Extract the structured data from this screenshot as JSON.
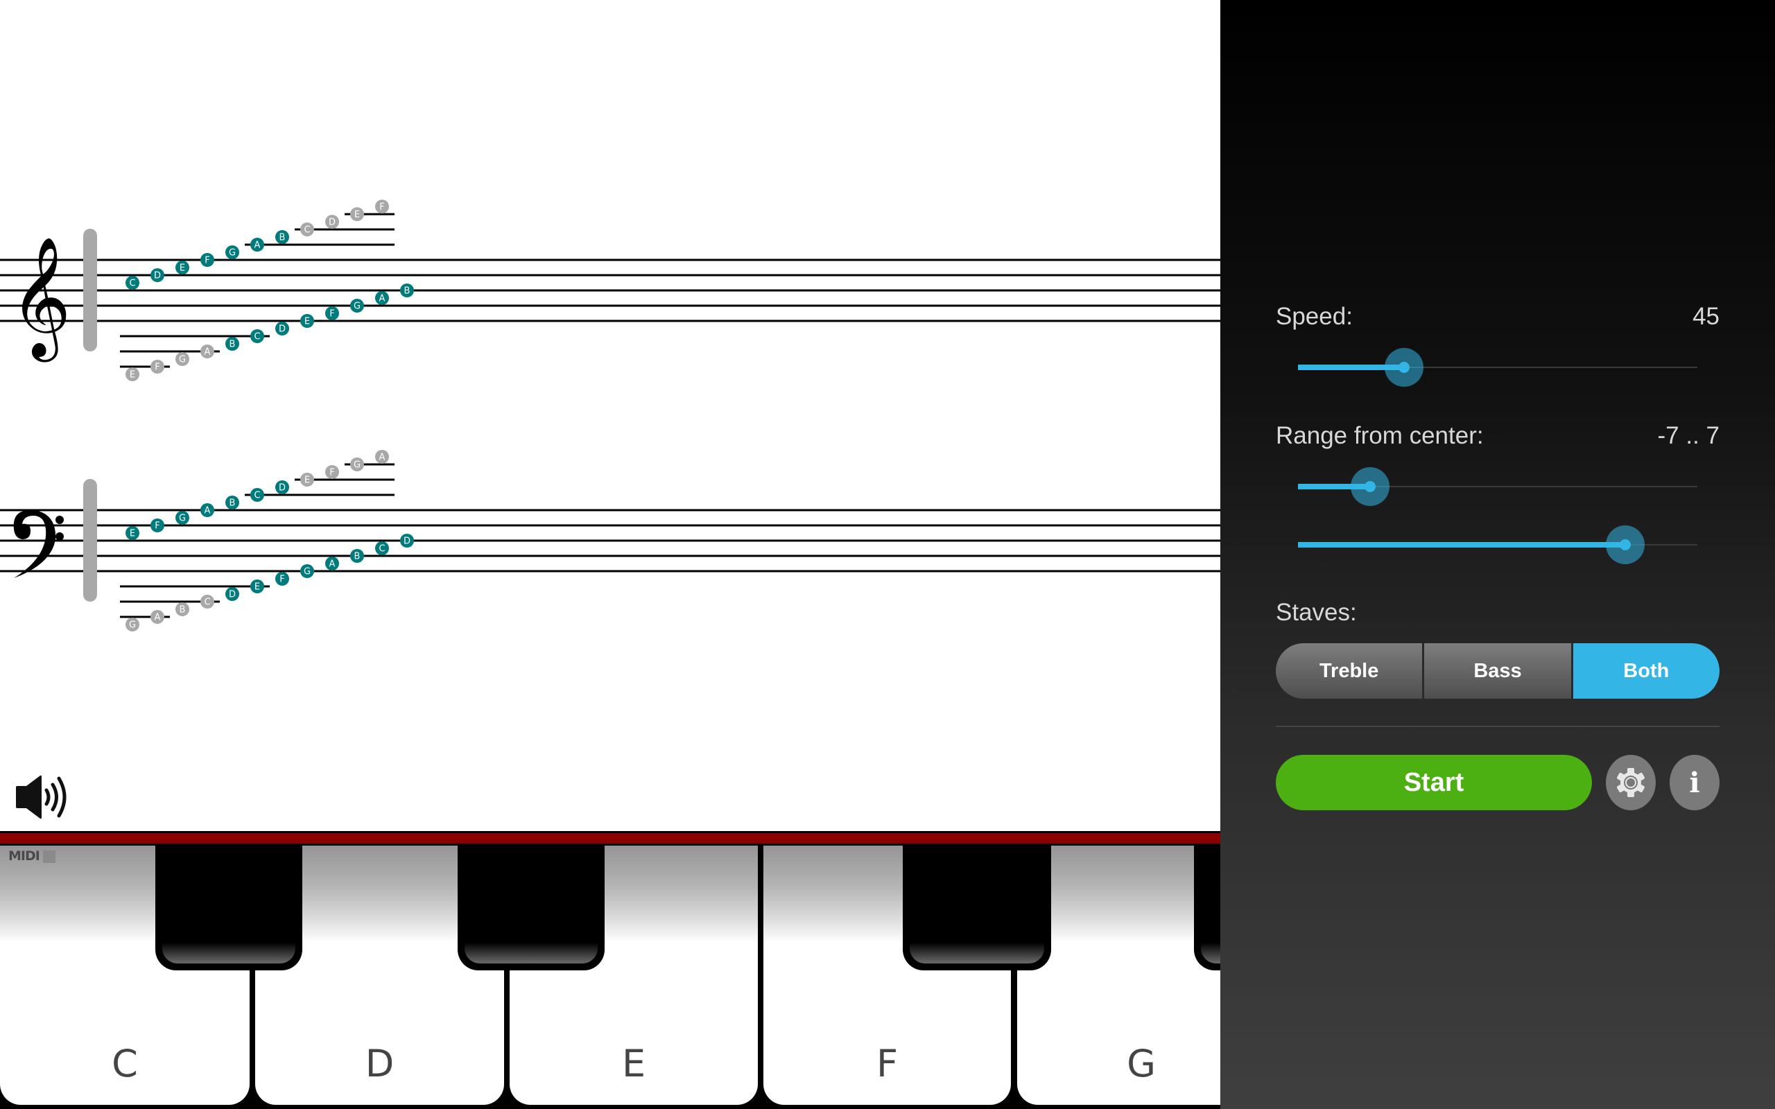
{
  "notation": {
    "treble": {
      "clef": "treble-clef",
      "upper_sequence": {
        "notes": [
          "C",
          "D",
          "E",
          "F",
          "G",
          "A",
          "B",
          "C",
          "D",
          "E",
          "F"
        ],
        "active": [
          true,
          true,
          true,
          true,
          true,
          true,
          true,
          false,
          false,
          false,
          false
        ]
      },
      "lower_sequence": {
        "notes": [
          "E",
          "F",
          "G",
          "A",
          "B",
          "C",
          "D",
          "E",
          "F",
          "G",
          "A",
          "B"
        ],
        "active": [
          false,
          false,
          false,
          false,
          true,
          true,
          true,
          true,
          true,
          true,
          true,
          true
        ]
      }
    },
    "bass": {
      "clef": "bass-clef",
      "upper_sequence": {
        "notes": [
          "E",
          "F",
          "G",
          "A",
          "B",
          "C",
          "D",
          "E",
          "F",
          "G",
          "A"
        ],
        "active": [
          true,
          true,
          true,
          true,
          true,
          true,
          true,
          false,
          false,
          false,
          false
        ]
      },
      "lower_sequence": {
        "notes": [
          "G",
          "A",
          "B",
          "C",
          "D",
          "E",
          "F",
          "G",
          "A",
          "B",
          "C",
          "D"
        ],
        "active": [
          false,
          false,
          false,
          false,
          true,
          true,
          true,
          true,
          true,
          true,
          true,
          true
        ]
      }
    },
    "colors": {
      "active_note": "#007b7b",
      "inactive_note": "#a8a8a8"
    }
  },
  "sound": {
    "icon": "speaker-volume-icon"
  },
  "keyboard": {
    "midi_label": "MIDI",
    "white_keys": [
      "C",
      "D",
      "E",
      "F",
      "G"
    ],
    "accent_bar_color": "#8b0000"
  },
  "panel": {
    "speed": {
      "label": "Speed:",
      "value": "45",
      "fraction": 0.266
    },
    "range": {
      "label": "Range from center:",
      "value": "-7 .. 7",
      "min_value": -7,
      "max_value": 7,
      "min_fraction": 0.18,
      "max_fraction": 0.82
    },
    "staves": {
      "label": "Staves:",
      "options": [
        "Treble",
        "Bass",
        "Both"
      ],
      "selected": "Both"
    },
    "start_label": "Start",
    "settings_icon": "gear-icon",
    "info_icon": "info-icon",
    "info_glyph": "i",
    "accent_color": "#33b5e5",
    "start_color": "#4caf12"
  }
}
